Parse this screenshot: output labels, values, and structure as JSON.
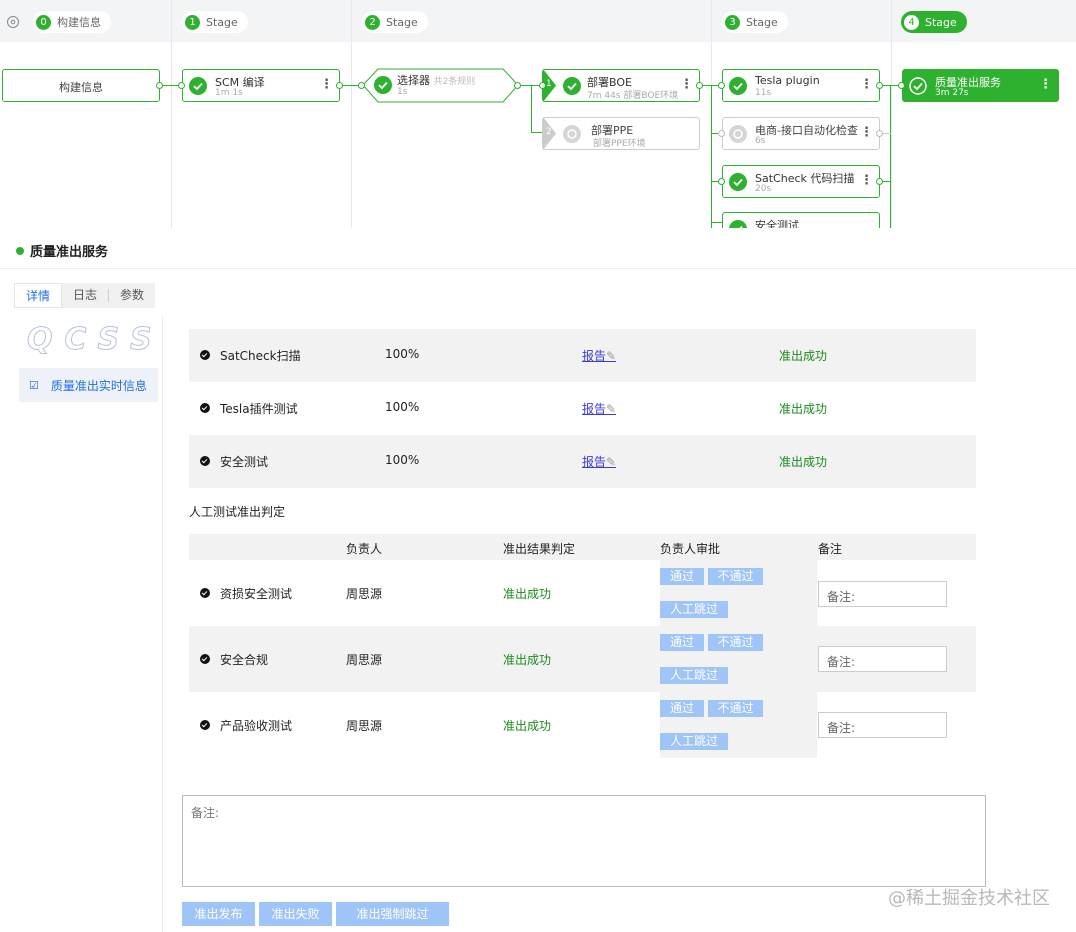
{
  "colors": {
    "success": "#2fb130",
    "link": "#3b3bd6",
    "button": "#9fc4f7"
  },
  "stages": [
    {
      "num": "0",
      "label": "构建信息"
    },
    {
      "num": "1",
      "label": "Stage"
    },
    {
      "num": "2",
      "label": "Stage"
    },
    {
      "num": "3",
      "label": "Stage"
    },
    {
      "num": "4",
      "label": "Stage"
    }
  ],
  "nodes": {
    "build_info": {
      "title": "构建信息"
    },
    "scm": {
      "title": "SCM 编译",
      "sub": "1m 1s"
    },
    "selector": {
      "title": "选择器",
      "hint": "共2条规则",
      "sub": "1s"
    },
    "deploy_boe": {
      "badge": "1",
      "title": "部署BOE",
      "sub": "7m 44s",
      "note": "部署BOE环境"
    },
    "deploy_ppe": {
      "badge": "2",
      "title": "部署PPE",
      "note": "部署PPE环境"
    },
    "tesla": {
      "title": "Tesla plugin",
      "sub": "11s"
    },
    "ecommerce": {
      "title": "电商-接口自动化检查",
      "sub": "6s"
    },
    "satcheck": {
      "title": "SatCheck 代码扫描",
      "sub": "20s"
    },
    "security": {
      "title": "安全测试"
    },
    "quality": {
      "title": "质量准出服务",
      "sub": "3m 27s"
    }
  },
  "detail": {
    "title": "质量准出服务",
    "tabs": [
      "详情",
      "日志",
      "参数"
    ],
    "logo": "QCSS",
    "side_item": "质量准出实时信息",
    "auto_checks": [
      {
        "name": "SatCheck扫描",
        "rate": "100%",
        "report": "报告",
        "result": "准出成功"
      },
      {
        "name": "Tesla插件测试",
        "rate": "100%",
        "report": "报告",
        "result": "准出成功"
      },
      {
        "name": "安全测试",
        "rate": "100%",
        "report": "报告",
        "result": "准出成功"
      }
    ],
    "manual_title": "人工测试准出判定",
    "manual_headers": {
      "owner": "负责人",
      "result": "准出结果判定",
      "approval": "负责人审批",
      "remark": "备注"
    },
    "manual_rows": [
      {
        "name": "资损安全测试",
        "owner": "周思源",
        "result": "准出成功"
      },
      {
        "name": "安全合规",
        "owner": "周思源",
        "result": "准出成功"
      },
      {
        "name": "产品验收测试",
        "owner": "周思源",
        "result": "准出成功"
      }
    ],
    "approve_labels": {
      "pass": "通过",
      "fail": "不通过",
      "skip": "人工跳过"
    },
    "remark_label": "备注:",
    "big_remark": "备注:",
    "footer_buttons": [
      "准出发布",
      "准出失败",
      "准出强制跳过"
    ]
  },
  "watermark": "@稀土掘金技术社区"
}
